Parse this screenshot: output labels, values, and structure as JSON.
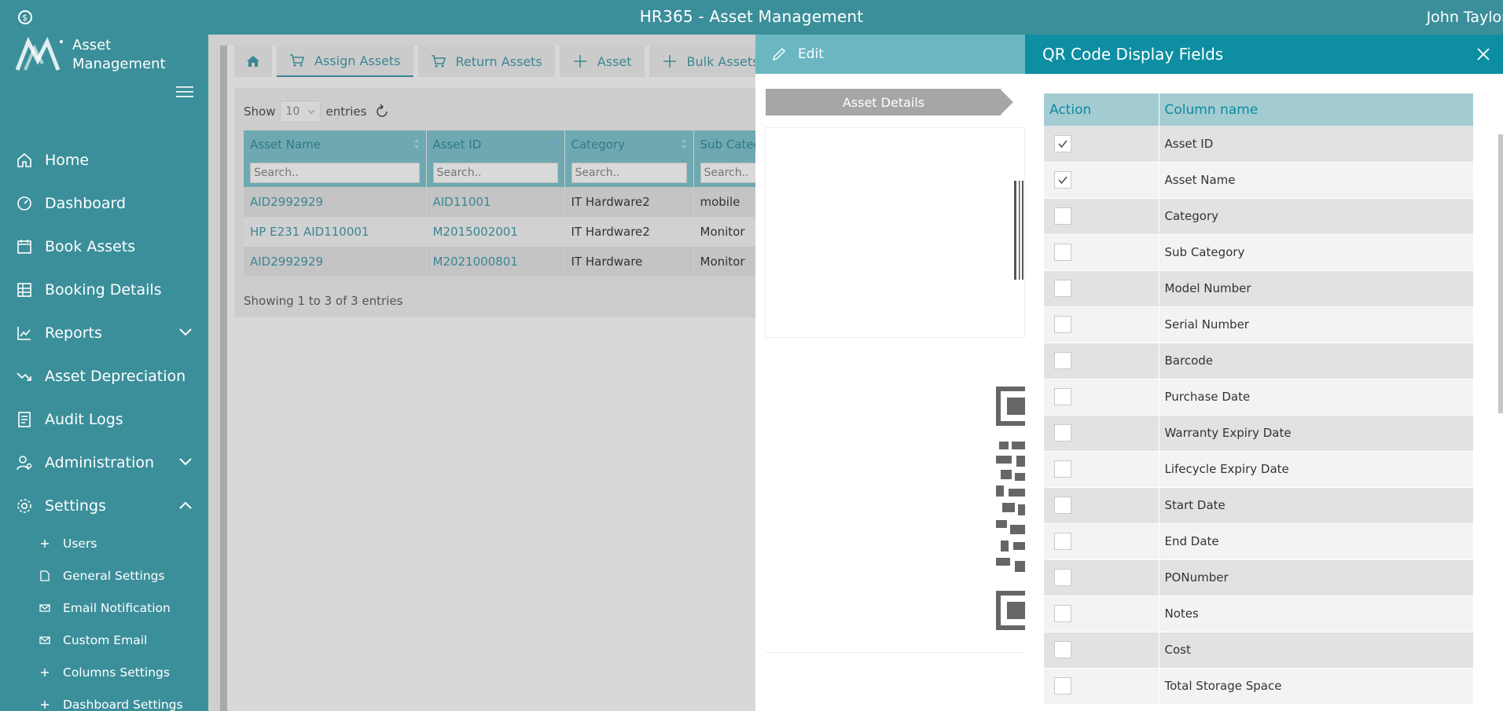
{
  "app": {
    "title": "HR365 - Asset Management",
    "user": "John Taylor"
  },
  "brand": {
    "line1": "Asset",
    "line2": "Management"
  },
  "sidebar": {
    "items": [
      {
        "label": "Home",
        "icon": "home-icon"
      },
      {
        "label": "Dashboard",
        "icon": "dashboard-icon"
      },
      {
        "label": "Book Assets",
        "icon": "calendar-icon"
      },
      {
        "label": "Booking Details",
        "icon": "table-icon"
      },
      {
        "label": "Reports",
        "icon": "chart-line-icon"
      },
      {
        "label": "Asset Depreciation",
        "icon": "trend-down-icon"
      },
      {
        "label": "Audit Logs",
        "icon": "log-icon"
      },
      {
        "label": "Administration",
        "icon": "admin-user-icon"
      },
      {
        "label": "Settings",
        "icon": "gear-icon"
      }
    ],
    "settings_sub": [
      {
        "label": "Users",
        "icon": "plus-icon"
      },
      {
        "label": "General Settings",
        "icon": "page-icon"
      },
      {
        "label": "Email Notification",
        "icon": "mail-icon"
      },
      {
        "label": "Custom Email",
        "icon": "mail-icon"
      },
      {
        "label": "Columns Settings",
        "icon": "plus-icon"
      },
      {
        "label": "Dashboard Settings",
        "icon": "plus-icon"
      }
    ]
  },
  "tabs": [
    {
      "label": "Assign Assets"
    },
    {
      "label": "Return Assets"
    },
    {
      "label": "Asset"
    },
    {
      "label": "Bulk Assets"
    }
  ],
  "table": {
    "show_label": "Show",
    "entries_label": "entries",
    "page_size": "10",
    "search_placeholder": "Search..",
    "columns": [
      "Asset Name",
      "Asset ID",
      "Category",
      "Sub Category"
    ],
    "rows": [
      [
        "AID2992929",
        "AID11001",
        "IT Hardware2",
        "mobile"
      ],
      [
        "HP E231 AID110001",
        "M2015002001",
        "IT Hardware2",
        "Monitor"
      ],
      [
        "AID2992929",
        "M2021000801",
        "IT Hardware",
        "Monitor"
      ]
    ],
    "footer": "Showing 1 to 3 of 3 entries"
  },
  "edit": {
    "title": "Edit",
    "step": "Asset Details"
  },
  "qr": {
    "title": "QR Code Display Fields",
    "col_action": "Action",
    "col_name": "Column name",
    "fields": [
      {
        "name": "Asset ID",
        "checked": true
      },
      {
        "name": "Asset Name",
        "checked": true
      },
      {
        "name": "Category",
        "checked": false
      },
      {
        "name": "Sub Category",
        "checked": false
      },
      {
        "name": "Model Number",
        "checked": false
      },
      {
        "name": "Serial Number",
        "checked": false
      },
      {
        "name": "Barcode",
        "checked": false
      },
      {
        "name": "Purchase Date",
        "checked": false
      },
      {
        "name": "Warranty Expiry Date",
        "checked": false
      },
      {
        "name": "Lifecycle Expiry Date",
        "checked": false
      },
      {
        "name": "Start Date",
        "checked": false
      },
      {
        "name": "End Date",
        "checked": false
      },
      {
        "name": "PONumber",
        "checked": false
      },
      {
        "name": "Notes",
        "checked": false
      },
      {
        "name": "Cost",
        "checked": false
      },
      {
        "name": "Total Storage Space",
        "checked": false
      }
    ]
  }
}
